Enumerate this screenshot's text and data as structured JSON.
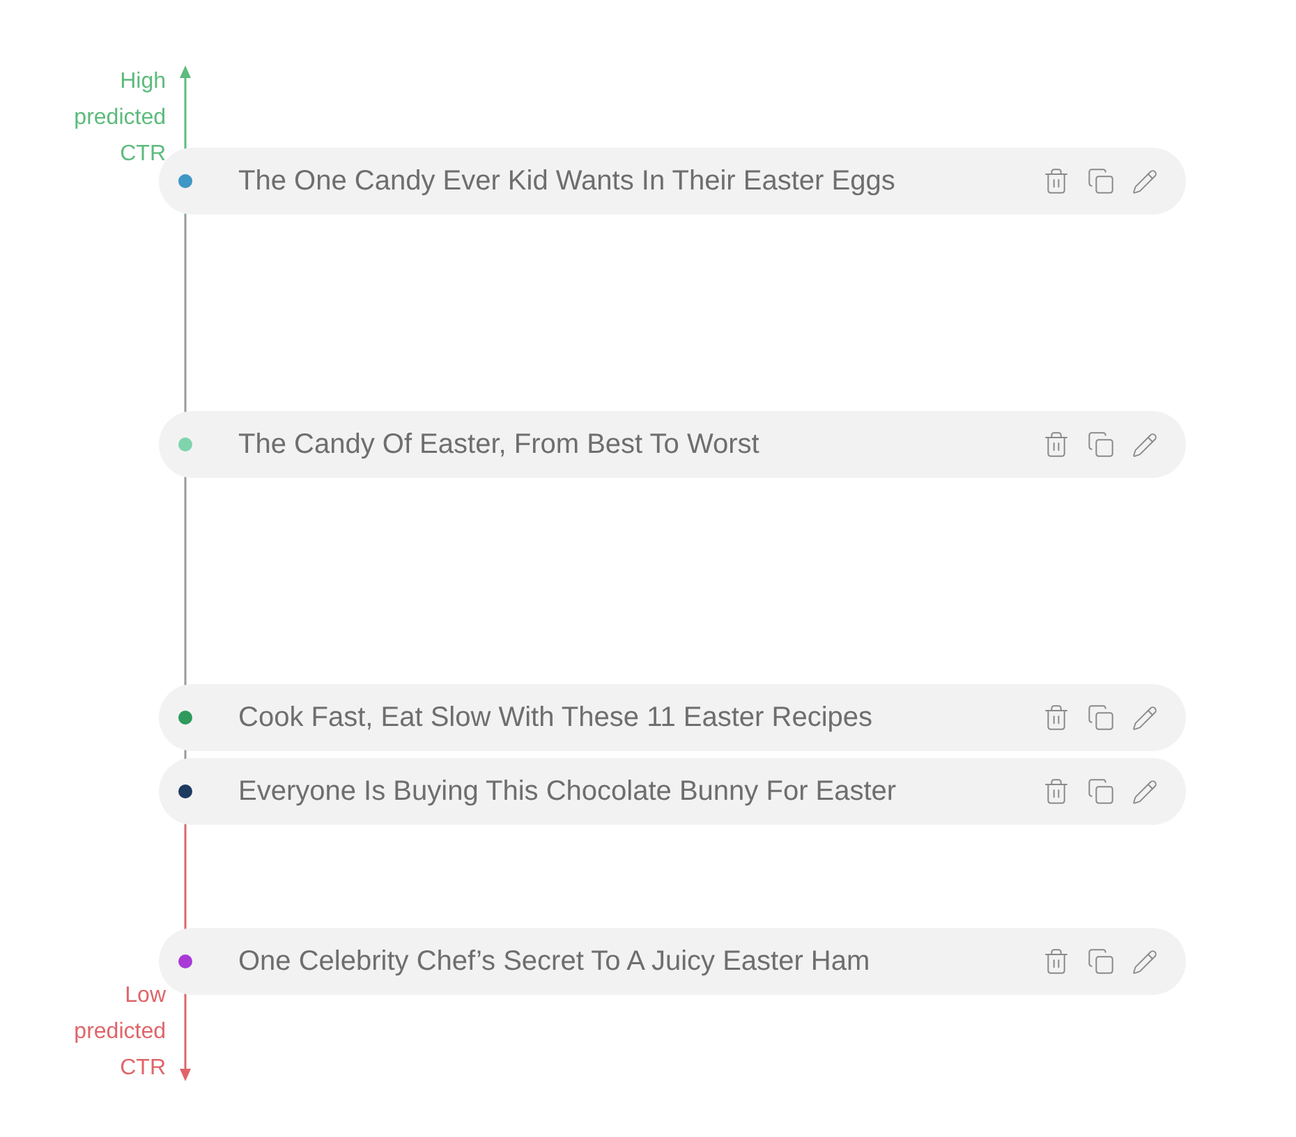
{
  "axis": {
    "high_label": "High predicted CTR",
    "low_label": "Low predicted CTR"
  },
  "headlines": [
    {
      "title": "The One Candy Ever Kid Wants In Their Easter Eggs",
      "color": "#3e97c6"
    },
    {
      "title": "The Candy Of Easter, From Best To Worst",
      "color": "#7fd4ad"
    },
    {
      "title": "Cook Fast, Eat Slow With These 11 Easter Recipes",
      "color": "#2f9a5c"
    },
    {
      "title": "Everyone Is Buying This Chocolate Bunny For Easter",
      "color": "#1d3a5f"
    },
    {
      "title": "One Celebrity Chef’s Secret To A Juicy Easter Ham",
      "color": "#a93ad6"
    }
  ]
}
